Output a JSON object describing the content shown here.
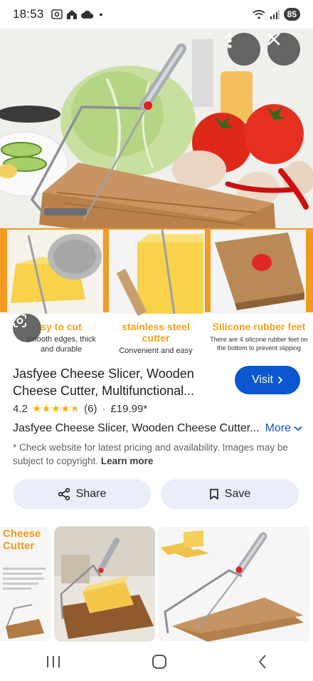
{
  "status_bar": {
    "time": "18:53",
    "battery": "85"
  },
  "hero": {
    "features": [
      {
        "title": "sy to cut",
        "desc": "smooth edges, thick and durable"
      },
      {
        "title": "stainless steel cutter",
        "desc": "Convenient and easy to clean"
      },
      {
        "title": "Silicone rubber feet",
        "desc": "There are 4 silicone rubber feet on the bottom to prevent slipping"
      }
    ]
  },
  "product": {
    "title": "Jasfyee Cheese Slicer, Wooden Cheese Cutter, Multifunctional...",
    "visit_label": "Visit",
    "rating": "4.2",
    "stars": 4.2,
    "reviews": "(6)",
    "separator": "·",
    "price": "£19.99*",
    "store_name": "Jasfyee Cheese Slicer, Wooden Cheese Cutter...",
    "more_label": "More",
    "disclaimer": "* Check website for latest pricing and availability. Images may be subject to copyright.",
    "learn_more": "Learn more"
  },
  "actions": {
    "share_label": "Share",
    "save_label": "Save"
  },
  "related": {
    "first_caption": "Cheese Cutter"
  },
  "colors": {
    "accent": "#0b57d0",
    "star": "#f7b400",
    "feature_text": "#f2a21e"
  }
}
